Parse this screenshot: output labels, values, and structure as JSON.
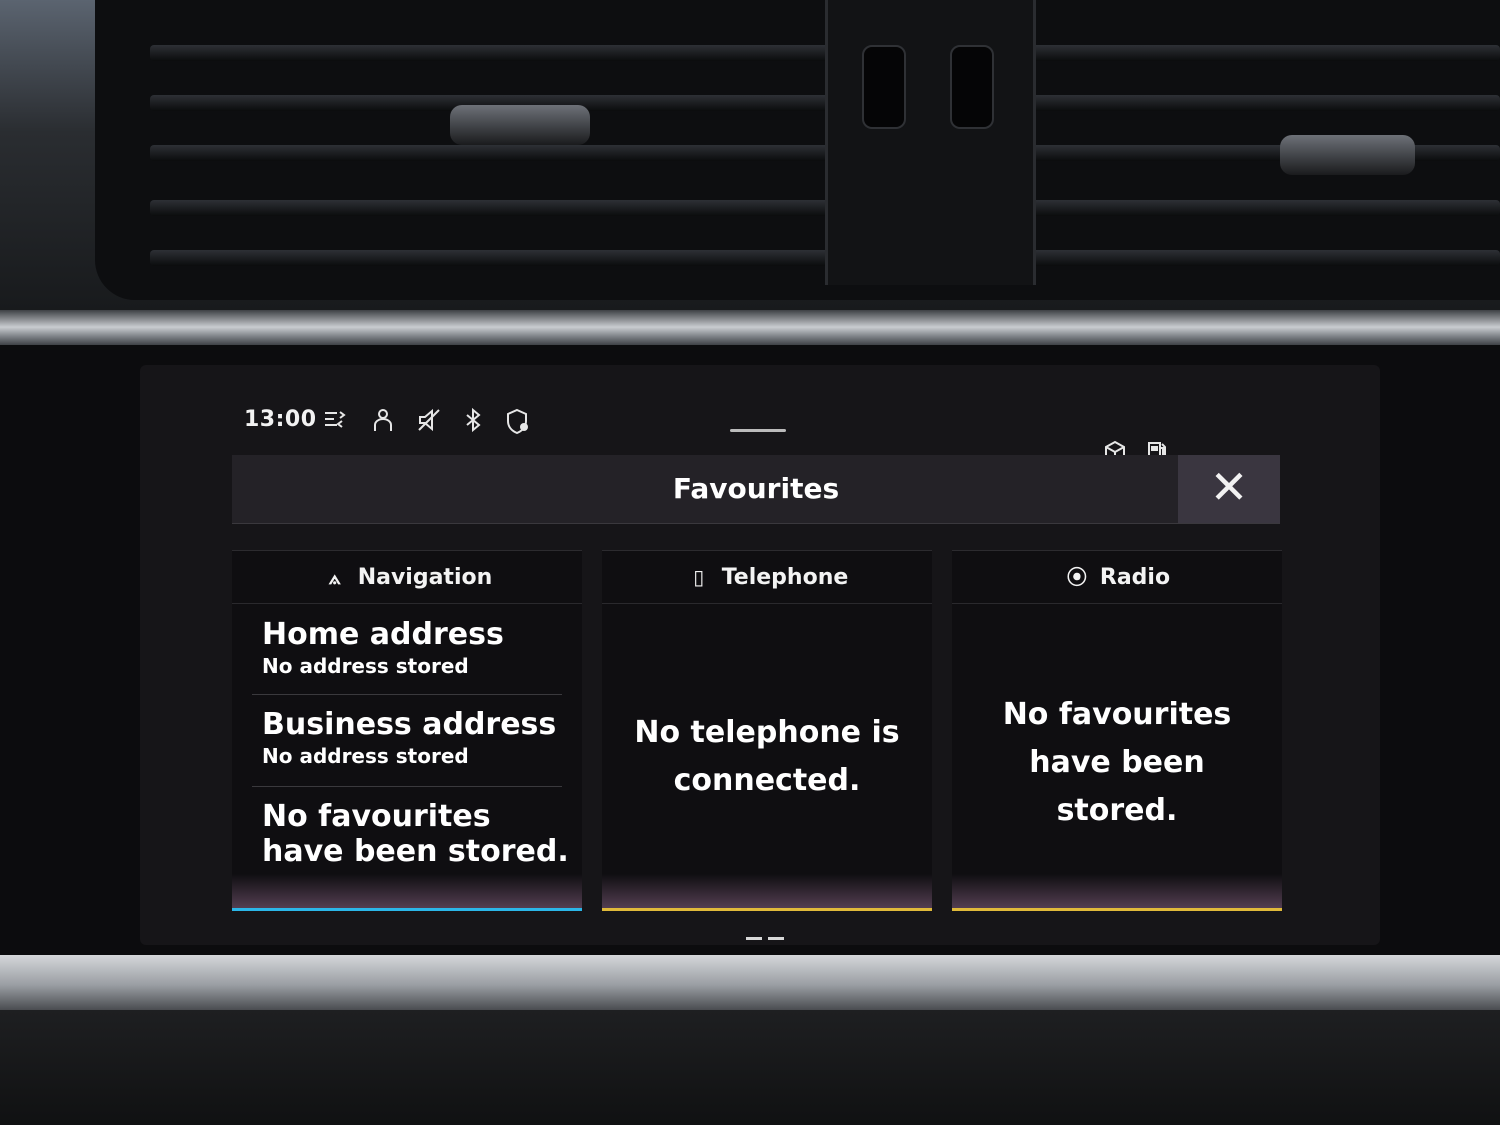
{
  "status_bar": {
    "time": "13:00",
    "icons": [
      "traffic-info-icon",
      "person-icon",
      "mute-icon",
      "bluetooth-icon",
      "location-shield-icon",
      "cube-icon",
      "fuel-icon"
    ]
  },
  "header": {
    "title": "Favourites",
    "close_glyph": "✕"
  },
  "navigation": {
    "label": "Navigation",
    "icon_glyph": "⟑",
    "items": [
      {
        "title": "Home address",
        "subtitle": "No address stored"
      },
      {
        "title": "Business address",
        "subtitle": "No address stored"
      }
    ],
    "empty_line1": "No favourites",
    "empty_line2": "have been stored.",
    "accent_color": "#2bb6e8"
  },
  "telephone": {
    "label": "Telephone",
    "icon_glyph": "▯",
    "message_line1": "No telephone is",
    "message_line2": "connected.",
    "accent_color": "#e0b93a"
  },
  "radio": {
    "label": "Radio",
    "icon_glyph": "⦿",
    "message_line1": "No favourites",
    "message_line2": "have been",
    "message_line3": "stored.",
    "accent_color": "#e0b93a"
  }
}
